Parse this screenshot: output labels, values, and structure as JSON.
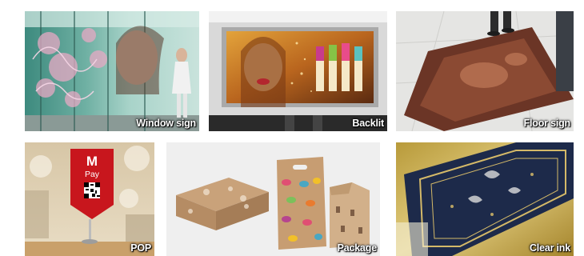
{
  "tiles": [
    {
      "id": "window",
      "caption": "Window sign"
    },
    {
      "id": "backlit",
      "caption": "Backlit"
    },
    {
      "id": "floor",
      "caption": "Floor sign"
    },
    {
      "id": "pop",
      "caption": "POP"
    },
    {
      "id": "package",
      "caption": "Package"
    },
    {
      "id": "clear",
      "caption": "Clear ink"
    }
  ],
  "pop_sign": {
    "letter": "M",
    "word": "Pay",
    "icon": "qr-code-icon"
  },
  "colors": {
    "caption_text": "#ffffff",
    "pop_red": "#c8161d"
  }
}
